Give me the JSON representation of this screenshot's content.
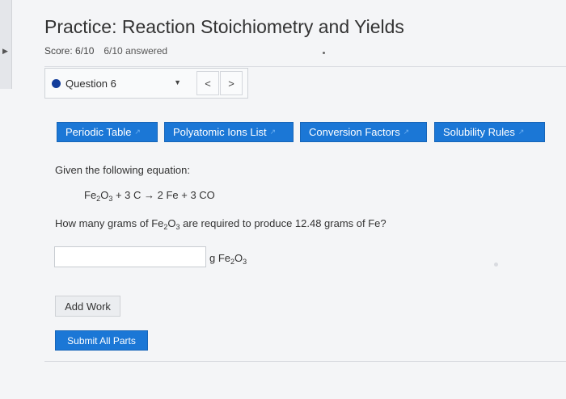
{
  "header": {
    "title": "Practice: Reaction Stoichiometry and Yields",
    "score": "Score: 6/10",
    "answered": "6/10 answered"
  },
  "question_nav": {
    "selected": "Question 6",
    "prev_label": "<",
    "next_label": ">"
  },
  "resources": [
    {
      "label": "Periodic Table"
    },
    {
      "label": "Polyatomic Ions List"
    },
    {
      "label": "Conversion Factors"
    },
    {
      "label": "Solubility Rules"
    }
  ],
  "problem": {
    "prompt": "Given the following equation:",
    "eq_fe": "Fe",
    "eq_sub2": "2",
    "eq_o": "O",
    "eq_sub3": "3",
    "eq_rest": "+ 3 C → 2 Fe + 3 CO",
    "q_part1": "How many grams of Fe",
    "q_sub2": "2",
    "q_o": "O",
    "q_sub3": "3",
    "q_part2": "are required to produce 12.48 grams of Fe?"
  },
  "answer": {
    "value": "",
    "unit_g": "g Fe",
    "unit_sub2": "2",
    "unit_o": "O",
    "unit_sub3": "3"
  },
  "actions": {
    "add_work": "Add Work",
    "submit": "Submit All Parts"
  },
  "colors": {
    "accent": "#1b77d6",
    "question_dot": "#123c9a"
  },
  "icons": [
    "expand-arrow-icon",
    "dropdown-caret-icon",
    "external-link-icon"
  ]
}
